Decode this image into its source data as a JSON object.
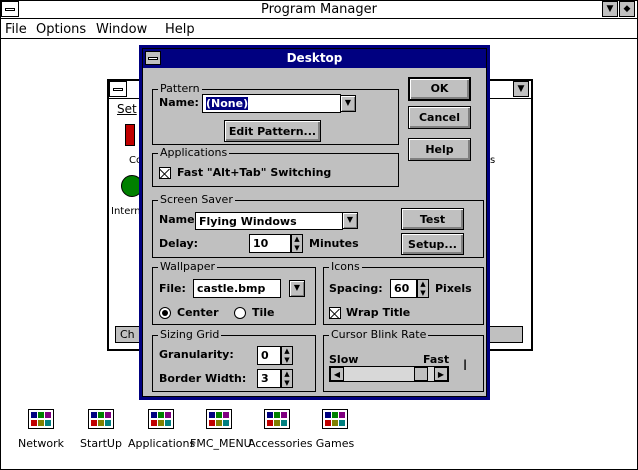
{
  "program_manager": {
    "title": "Program Manager",
    "menu": [
      "File",
      "Options",
      "Window",
      "Help"
    ],
    "minimize": "▼",
    "restore": "◆"
  },
  "group_window": {
    "menu_text": "Set",
    "partial_labels": [
      "Co",
      "Interna",
      "s",
      "Ch"
    ],
    "minimize": "▼"
  },
  "desktop_dialog": {
    "title": "Desktop",
    "pattern": {
      "legend": "Pattern",
      "name_label": "Name:",
      "name_value": "(None)",
      "edit_button": "Edit Pattern..."
    },
    "buttons": {
      "ok": "OK",
      "cancel": "Cancel",
      "help": "Help"
    },
    "applications": {
      "legend": "Applications",
      "fast_switch_label": "Fast \"Alt+Tab\" Switching",
      "fast_switch_checked": true
    },
    "screen_saver": {
      "legend": "Screen Saver",
      "name_label": "Name:",
      "name_value": "Flying Windows",
      "delay_label": "Delay:",
      "delay_value": "10",
      "delay_unit": "Minutes",
      "test_button": "Test",
      "setup_button": "Setup..."
    },
    "wallpaper": {
      "legend": "Wallpaper",
      "file_label": "File:",
      "file_value": "castle.bmp",
      "center_label": "Center",
      "tile_label": "Tile",
      "selected": "Center"
    },
    "icons": {
      "legend": "Icons",
      "spacing_label": "Spacing:",
      "spacing_value": "60",
      "spacing_unit": "Pixels",
      "wrap_label": "Wrap Title",
      "wrap_checked": true
    },
    "sizing_grid": {
      "legend": "Sizing Grid",
      "granularity_label": "Granularity:",
      "granularity_value": "0",
      "border_label": "Border Width:",
      "border_value": "3"
    },
    "cursor_blink": {
      "legend": "Cursor Blink Rate",
      "slow_label": "Slow",
      "fast_label": "Fast",
      "cursor_glyph": "I"
    }
  },
  "group_icons": [
    {
      "label": "Network"
    },
    {
      "label": "StartUp"
    },
    {
      "label": "Applications"
    },
    {
      "label": "FMC_MENU"
    },
    {
      "label": "Accessories"
    },
    {
      "label": "Games"
    }
  ],
  "colors": {
    "dialog_title_bg": "#000080",
    "dialog_bg": "#c0c0c0",
    "selection": "#000080"
  }
}
